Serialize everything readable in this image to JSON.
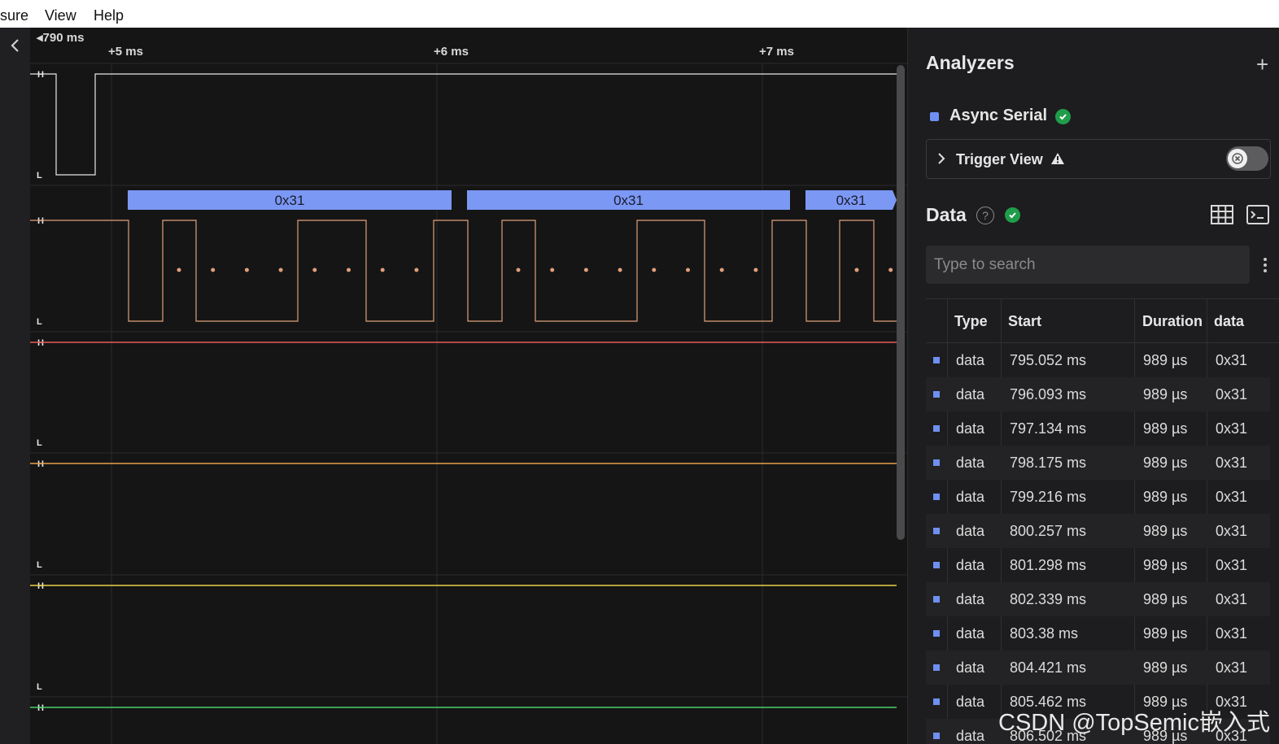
{
  "menubar": {
    "items": [
      "sure",
      "View",
      "Help"
    ]
  },
  "timeline": {
    "start_label": "790 ms",
    "ticks": [
      "+5 ms",
      "+6 ms",
      "+7 ms"
    ]
  },
  "channels": {
    "high_label": "H",
    "low_label": "L",
    "colors": [
      "#e8e8e8",
      "#e0a07a",
      "#e85a5a",
      "#e8a24a",
      "#e8d24a",
      "#4ad06a"
    ]
  },
  "decode": {
    "labels": [
      "0x31",
      "0x31",
      "0x31"
    ],
    "color": "#7b98f5"
  },
  "analyzers": {
    "title": "Analyzers",
    "add_icon": "plus-icon",
    "items": [
      {
        "name": "Async Serial",
        "color": "#6f90f0",
        "status": "check-icon"
      }
    ]
  },
  "trigger": {
    "label": "Trigger View"
  },
  "data_section": {
    "title": "Data",
    "search_placeholder": "Type to search",
    "columns": [
      "Type",
      "Start",
      "Duration",
      "data"
    ],
    "rows": [
      {
        "type": "data",
        "start": "795.052 ms",
        "duration": "989 µs",
        "value": "0x31"
      },
      {
        "type": "data",
        "start": "796.093 ms",
        "duration": "989 µs",
        "value": "0x31"
      },
      {
        "type": "data",
        "start": "797.134 ms",
        "duration": "989 µs",
        "value": "0x31"
      },
      {
        "type": "data",
        "start": "798.175 ms",
        "duration": "989 µs",
        "value": "0x31"
      },
      {
        "type": "data",
        "start": "799.216 ms",
        "duration": "989 µs",
        "value": "0x31"
      },
      {
        "type": "data",
        "start": "800.257 ms",
        "duration": "989 µs",
        "value": "0x31"
      },
      {
        "type": "data",
        "start": "801.298 ms",
        "duration": "989 µs",
        "value": "0x31"
      },
      {
        "type": "data",
        "start": "802.339 ms",
        "duration": "989 µs",
        "value": "0x31"
      },
      {
        "type": "data",
        "start": "803.38 ms",
        "duration": "989 µs",
        "value": "0x31"
      },
      {
        "type": "data",
        "start": "804.421 ms",
        "duration": "989 µs",
        "value": "0x31"
      },
      {
        "type": "data",
        "start": "805.462 ms",
        "duration": "989 µs",
        "value": "0x31"
      },
      {
        "type": "data",
        "start": "806.502 ms",
        "duration": "989 µs",
        "value": "0x31"
      }
    ]
  },
  "watermark": "CSDN @TopSemic嵌入式"
}
